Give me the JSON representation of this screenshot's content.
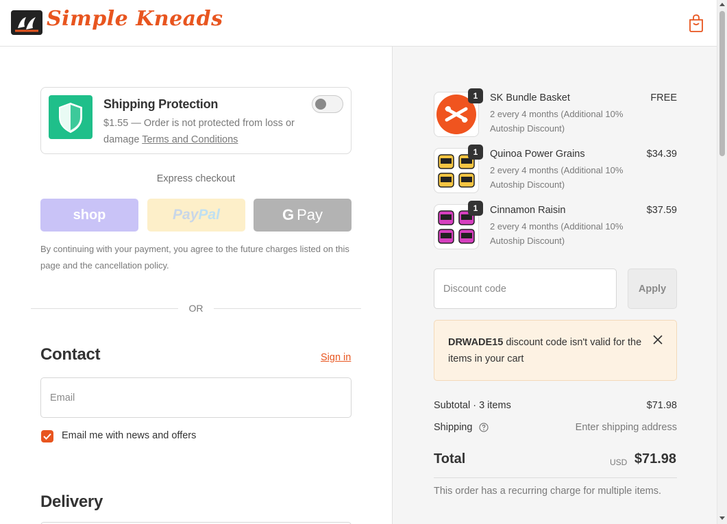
{
  "header": {
    "brand": "Simple Kneads",
    "logo_icon": "hands-logo-icon",
    "cart_icon": "shopping-bag-icon"
  },
  "shipping_protection": {
    "title": "Shipping Protection",
    "description": "$1.55 — Order is not protected from loss or damage",
    "terms_link": "Terms and Conditions",
    "icon": "shield-icon",
    "enabled": false
  },
  "express": {
    "label": "Express checkout",
    "shop_label": "shop",
    "paypal_label_1": "Pay",
    "paypal_label_2": "Pal",
    "gpay_label_g": "G",
    "gpay_label": "Pay"
  },
  "consent_text": "By continuing with your payment, you agree to the future charges listed on this page and the cancellation policy.",
  "divider_text": "OR",
  "contact": {
    "heading": "Contact",
    "sign_in": "Sign in",
    "email_placeholder": "Email",
    "news_label": "Email me with news and offers",
    "news_checked": true
  },
  "delivery": {
    "heading": "Delivery"
  },
  "cart": {
    "items": [
      {
        "name": "SK Bundle Basket",
        "subtitle": "2 every 4 months (Additional 10% Autoship Discount)",
        "price": "FREE",
        "qty": "1"
      },
      {
        "name": "Quinoa Power Grains",
        "subtitle": "2 every 4 months (Additional 10% Autoship Discount)",
        "price": "$34.39",
        "qty": "1"
      },
      {
        "name": "Cinnamon Raisin",
        "subtitle": "2 every 4 months (Additional 10% Autoship Discount)",
        "price": "$37.59",
        "qty": "1"
      }
    ]
  },
  "discount": {
    "placeholder": "Discount code",
    "apply_label": "Apply",
    "alert_code": "DRWADE15",
    "alert_message": " discount code isn't valid for the items in your cart"
  },
  "summary": {
    "subtotal_label": "Subtotal · 3 items",
    "subtotal_value": "$71.98",
    "shipping_label": "Shipping",
    "shipping_value": "Enter shipping address",
    "total_label": "Total",
    "total_currency": "USD",
    "total_value": "$71.98",
    "recurring_note": "This order has a recurring charge for multiple items."
  },
  "colors": {
    "accent": "#e8551f",
    "shield_bg": "#1fbf8a",
    "alert_bg": "#fdf2e3",
    "summary_bg": "#f5f5f5"
  }
}
